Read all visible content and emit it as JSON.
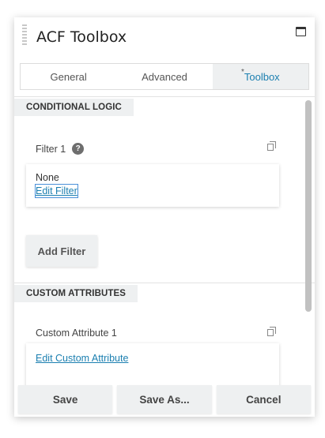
{
  "panel": {
    "title": "ACF Toolbox",
    "icons": {
      "grip": "drag-grip-icon",
      "maximize": "maximize-window-icon"
    }
  },
  "tabs": [
    {
      "label": "General",
      "active": false
    },
    {
      "label": "Advanced",
      "active": false
    },
    {
      "label": "Toolbox",
      "active": true,
      "modified_marker": "*"
    }
  ],
  "conditional_logic": {
    "heading": "CONDITIONAL LOGIC",
    "field_label": "Filter 1",
    "help_glyph": "?",
    "value": "None",
    "edit_link": "Edit Filter",
    "add_button": "Add Filter"
  },
  "custom_attributes": {
    "heading": "CUSTOM ATTRIBUTES",
    "field_label": "Custom Attribute 1",
    "edit_link": "Edit Custom Attribute"
  },
  "footer": {
    "save": "Save",
    "save_as": "Save As...",
    "cancel": "Cancel"
  },
  "colors": {
    "accent": "#1b7fb0",
    "section_bg": "#eef0f1",
    "border": "#dcdcdc"
  }
}
